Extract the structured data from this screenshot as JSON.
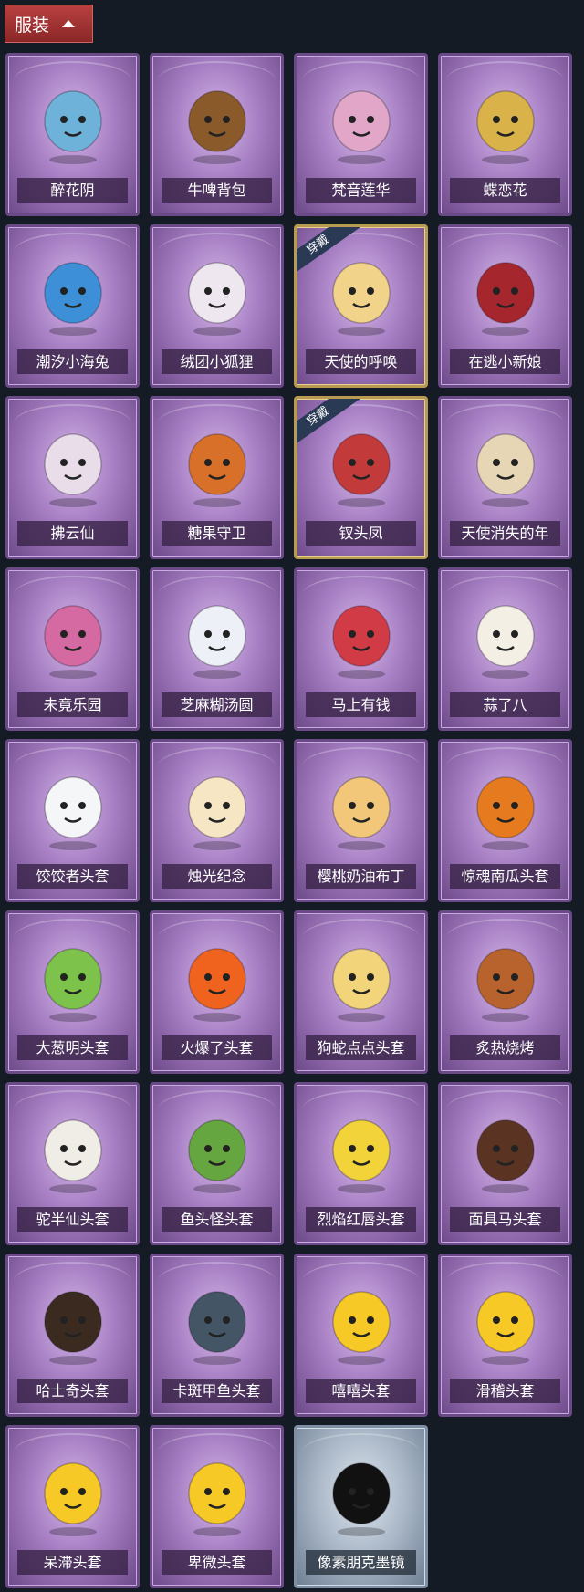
{
  "header": {
    "label": "服装"
  },
  "equipped_label": "穿戴",
  "items": [
    {
      "name": "醉花阴",
      "icon": "floral-wreath-icon",
      "color": "#6fb2d9"
    },
    {
      "name": "牛啤背包",
      "icon": "cow-barrel-icon",
      "color": "#8b5a2b"
    },
    {
      "name": "梵音莲华",
      "icon": "winged-doll-icon",
      "color": "#e2a7c8"
    },
    {
      "name": "蝶恋花",
      "icon": "butterfly-wreath-icon",
      "color": "#d9b24a"
    },
    {
      "name": "潮汐小海兔",
      "icon": "blue-bunny-icon",
      "color": "#3d8fd8"
    },
    {
      "name": "绒团小狐狸",
      "icon": "white-fox-icon",
      "color": "#efe7ef"
    },
    {
      "name": "天使的呼唤",
      "icon": "angel-doll-icon",
      "color": "#f1d38a",
      "equipped": true
    },
    {
      "name": "在逃小新娘",
      "icon": "red-lamp-icon",
      "color": "#a5262c"
    },
    {
      "name": "拂云仙",
      "icon": "cloud-fairy-icon",
      "color": "#e8dde8"
    },
    {
      "name": "糖果守卫",
      "icon": "pumpkin-scarecrow-icon",
      "color": "#d9702a"
    },
    {
      "name": "钗头凤",
      "icon": "phoenix-crown-icon",
      "color": "#c23a3a",
      "equipped": true
    },
    {
      "name": "天使消失的年",
      "icon": "sleeping-angel-icon",
      "color": "#e6d6b6"
    },
    {
      "name": "未竟乐园",
      "icon": "pink-doll-icon",
      "color": "#d56aa3"
    },
    {
      "name": "芝麻糊汤圆",
      "icon": "dumpling-icon",
      "color": "#eef0f7"
    },
    {
      "name": "马上有钱",
      "icon": "red-horse-icon",
      "color": "#d13b46"
    },
    {
      "name": "蒜了八",
      "icon": "garlic-icon",
      "color": "#f3efe4"
    },
    {
      "name": "饺饺者头套",
      "icon": "cloud-face-icon",
      "color": "#f4f6f8"
    },
    {
      "name": "烛光纪念",
      "icon": "candle-icon",
      "color": "#f6e6c4"
    },
    {
      "name": "樱桃奶油布丁",
      "icon": "pudding-icon",
      "color": "#f2c77a"
    },
    {
      "name": "惊魂南瓜头套",
      "icon": "pumpkin-icon",
      "color": "#e67a1e"
    },
    {
      "name": "大葱明头套",
      "icon": "green-onion-icon",
      "color": "#7dc24a"
    },
    {
      "name": "火爆了头套",
      "icon": "fire-face-icon",
      "color": "#f0631e"
    },
    {
      "name": "狗蛇点点头套",
      "icon": "snake-face-icon",
      "color": "#f2d47a"
    },
    {
      "name": "炙热烧烤",
      "icon": "meat-bone-icon",
      "color": "#b8632d"
    },
    {
      "name": "驼半仙头套",
      "icon": "sunglasses-bear-icon",
      "color": "#f0ece6"
    },
    {
      "name": "鱼头怪头套",
      "icon": "fish-head-icon",
      "color": "#66a640"
    },
    {
      "name": "烈焰红唇头套",
      "icon": "yellow-cat-icon",
      "color": "#f3d33a"
    },
    {
      "name": "面具马头套",
      "icon": "horse-mask-icon",
      "color": "#5b3322"
    },
    {
      "name": "哈士奇头套",
      "icon": "husky-icon",
      "color": "#3b2a20"
    },
    {
      "name": "卡斑甲鱼头套",
      "icon": "seal-head-icon",
      "color": "#445566"
    },
    {
      "name": "嘻嘻头套",
      "icon": "grin-emoji-icon",
      "color": "#f7c926"
    },
    {
      "name": "滑稽头套",
      "icon": "smirk-emoji-icon",
      "color": "#f7c926"
    },
    {
      "name": "呆滞头套",
      "icon": "stare-emoji-icon",
      "color": "#f7c926"
    },
    {
      "name": "卑微头套",
      "icon": "shy-emoji-icon",
      "color": "#f7c926"
    },
    {
      "name": "像素朋克墨镜",
      "icon": "pixel-sunglasses-icon",
      "color": "#111111",
      "silver": true
    }
  ]
}
